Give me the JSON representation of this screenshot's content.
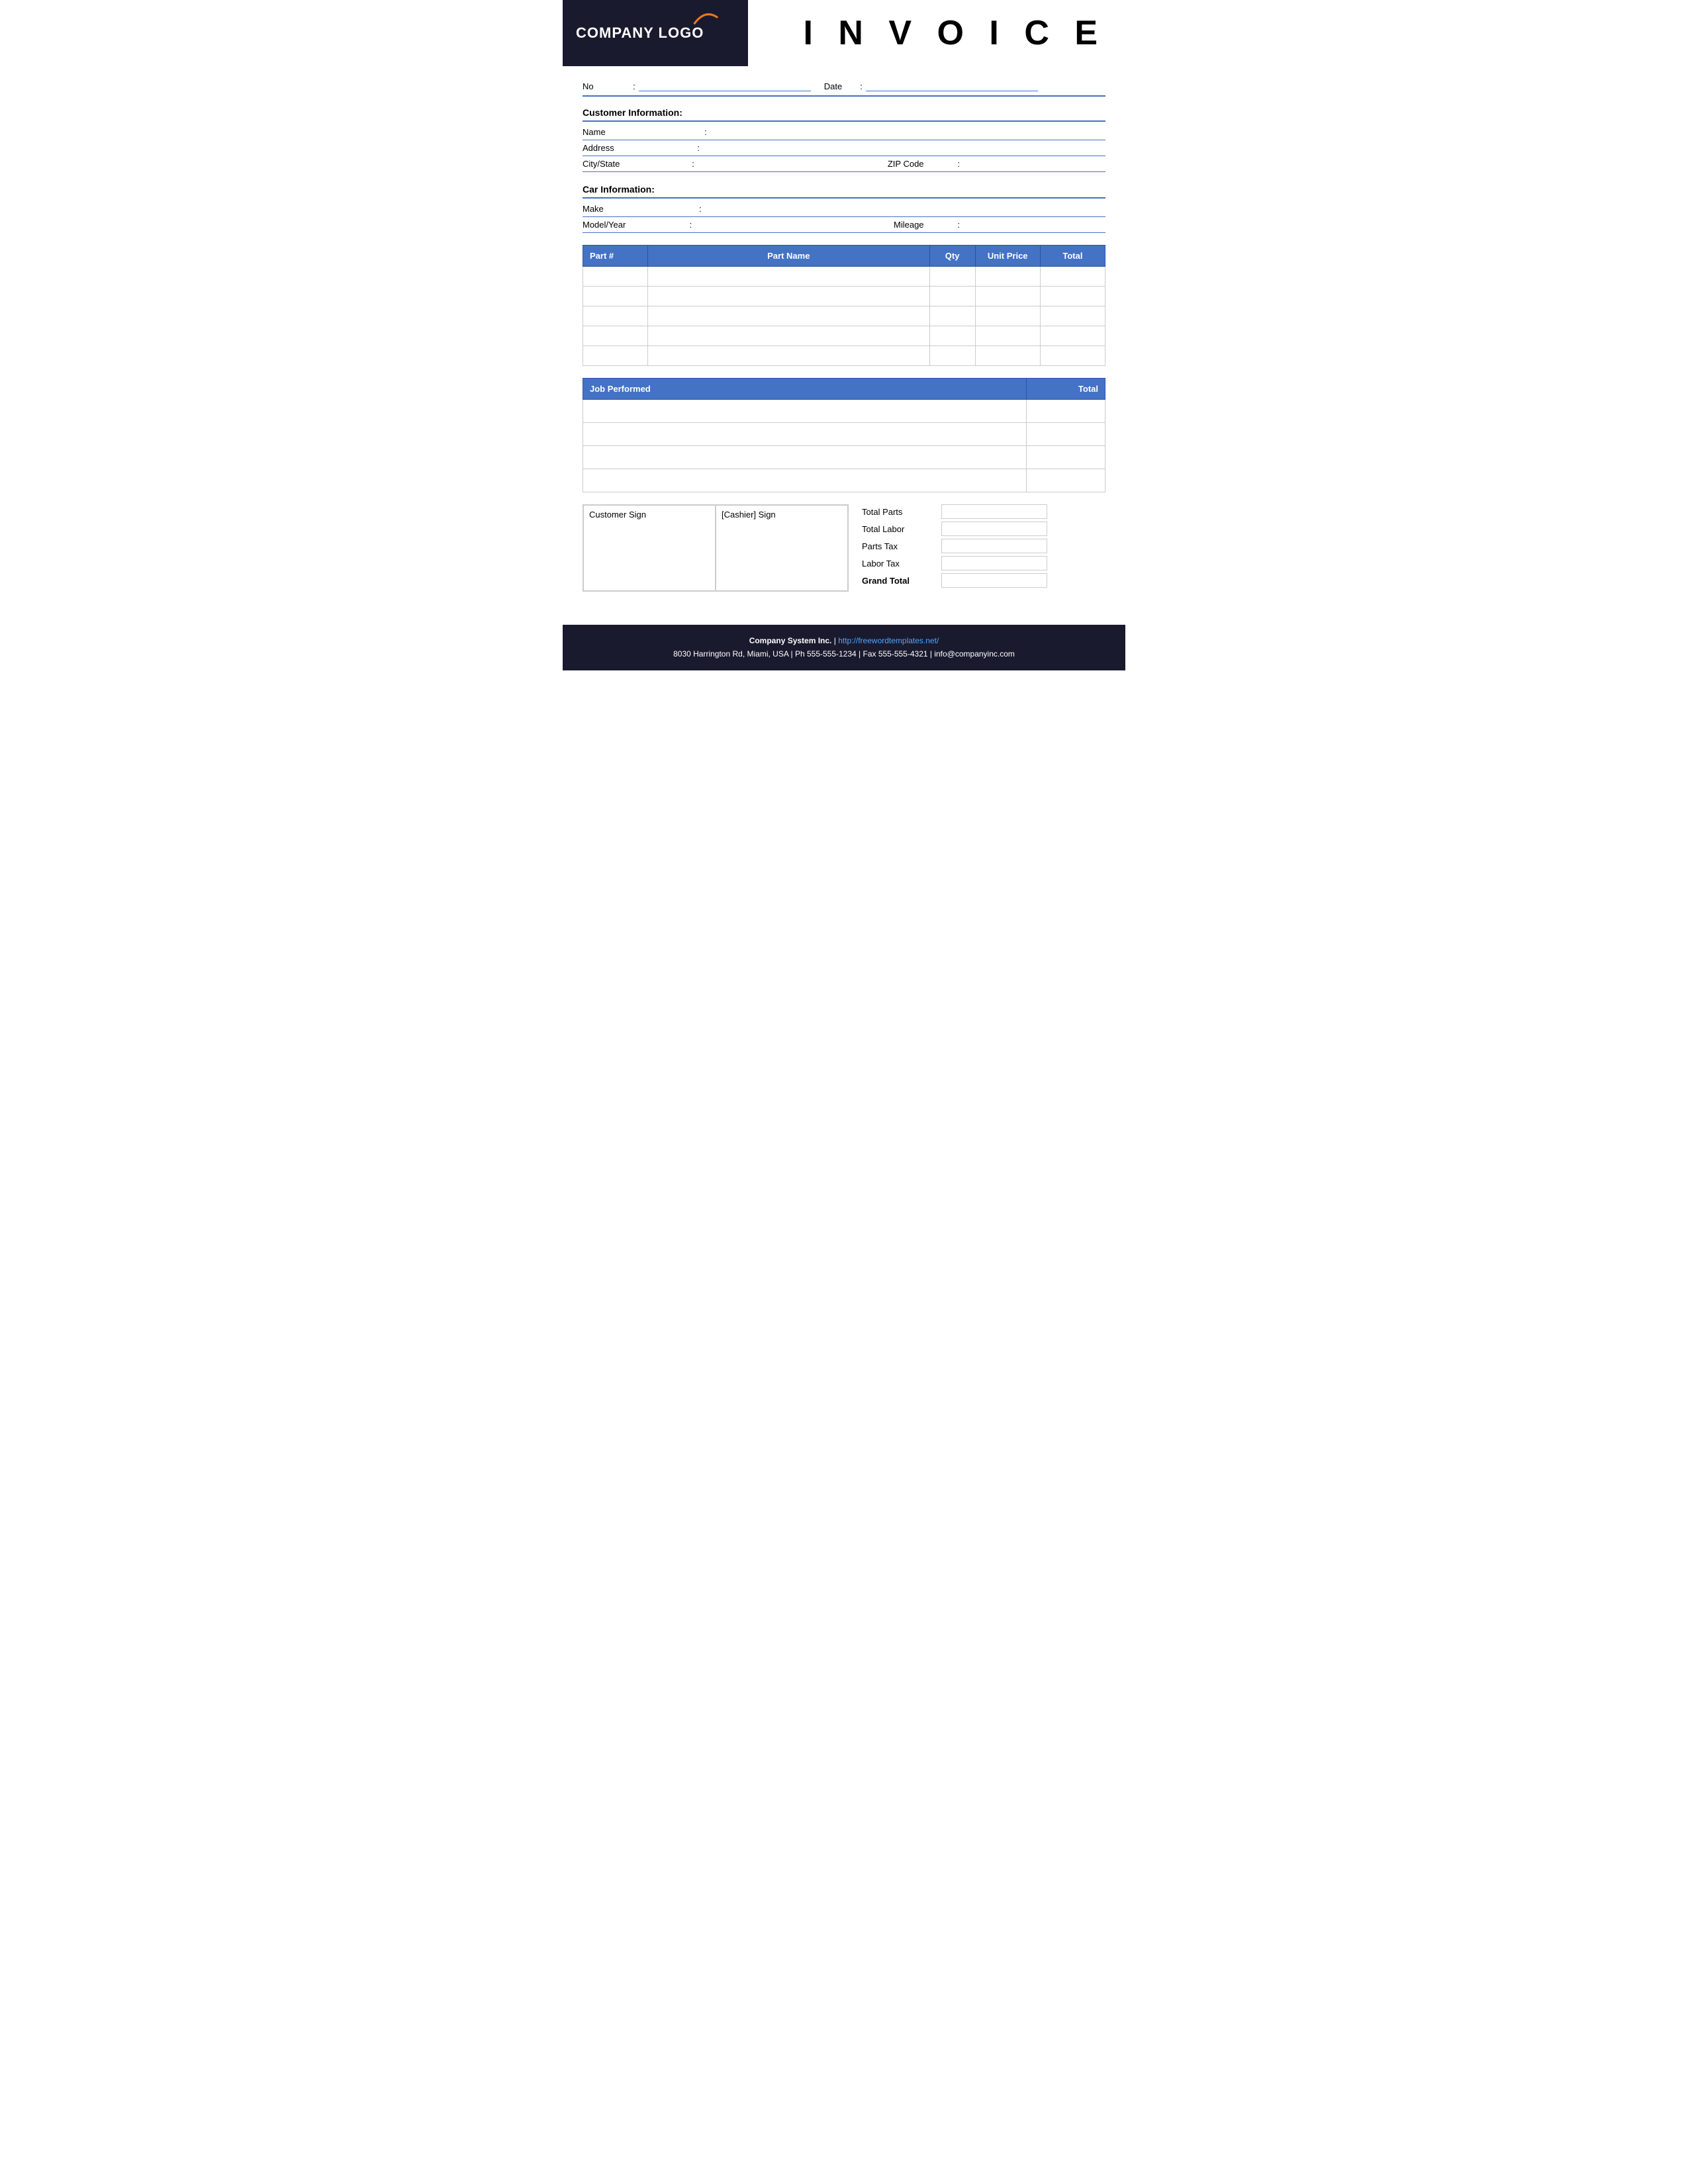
{
  "header": {
    "logo_text": "COMPANY LOGO",
    "invoice_title": "I N V O I C E"
  },
  "form": {
    "no_label": "No",
    "date_label": "Date",
    "colon": ":"
  },
  "customer_info": {
    "section_title": "Customer Information:",
    "name_label": "Name",
    "address_label": "Address",
    "city_state_label": "City/State",
    "zip_label": "ZIP Code",
    "colon": ":"
  },
  "car_info": {
    "section_title": "Car Information:",
    "make_label": "Make",
    "model_year_label": "Model/Year",
    "mileage_label": "Mileage",
    "colon": ":"
  },
  "parts_table": {
    "headers": [
      "Part #",
      "Part Name",
      "Qty",
      "Unit Price",
      "Total"
    ],
    "rows": [
      {
        "part_no": "",
        "part_name": "",
        "qty": "",
        "unit_price": "",
        "total": ""
      },
      {
        "part_no": "",
        "part_name": "",
        "qty": "",
        "unit_price": "",
        "total": ""
      },
      {
        "part_no": "",
        "part_name": "",
        "qty": "",
        "unit_price": "",
        "total": ""
      },
      {
        "part_no": "",
        "part_name": "",
        "qty": "",
        "unit_price": "",
        "total": ""
      },
      {
        "part_no": "",
        "part_name": "",
        "qty": "",
        "unit_price": "",
        "total": ""
      }
    ]
  },
  "job_table": {
    "headers": [
      "Job Performed",
      "Total"
    ],
    "rows": [
      {
        "job": "",
        "total": ""
      },
      {
        "job": "",
        "total": ""
      },
      {
        "job": "",
        "total": ""
      },
      {
        "job": "",
        "total": ""
      }
    ]
  },
  "signatures": {
    "customer_sign": "Customer Sign",
    "cashier_sign": "[Cashier] Sign"
  },
  "totals": {
    "total_parts_label": "Total Parts",
    "total_labor_label": "Total Labor",
    "parts_tax_label": "Parts Tax",
    "labor_tax_label": "Labor Tax",
    "grand_total_label": "Grand Total"
  },
  "footer": {
    "company": "Company System Inc.",
    "separator": " | ",
    "website": "http://freewordtemplates.net/",
    "address": "8030 Harrington Rd, Miami, USA | Ph 555-555-1234 | Fax 555-555-4321 | info@companyinc.com"
  }
}
